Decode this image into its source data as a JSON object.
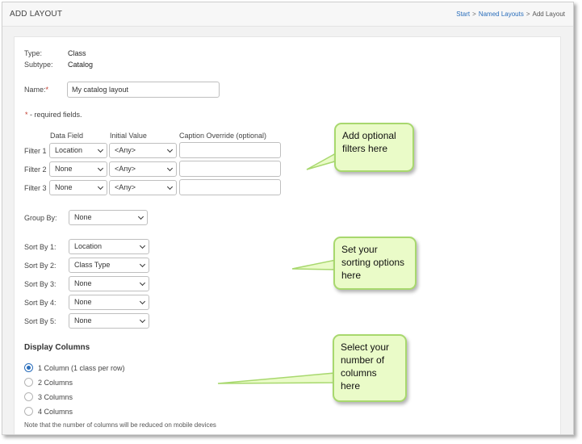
{
  "header": {
    "title": "ADD LAYOUT",
    "breadcrumb": {
      "start": "Start",
      "named_layouts": "Named Layouts",
      "current": "Add Layout",
      "sep": ">"
    }
  },
  "form": {
    "type_label": "Type:",
    "type_value": "Class",
    "subtype_label": "Subtype:",
    "subtype_value": "Catalog",
    "name_label": "Name:",
    "name_required_marker": "*",
    "name_value": "My catalog layout",
    "required_note_marker": "*",
    "required_note": " - required fields.",
    "filters": {
      "col_data_field": "Data Field",
      "col_initial_value": "Initial Value",
      "col_caption": "Caption Override (optional)",
      "rows": [
        {
          "label": "Filter 1",
          "data_field": "Location",
          "initial_value": "<Any>",
          "caption": ""
        },
        {
          "label": "Filter 2",
          "data_field": "None",
          "initial_value": "<Any>",
          "caption": ""
        },
        {
          "label": "Filter 3",
          "data_field": "None",
          "initial_value": "<Any>",
          "caption": ""
        }
      ]
    },
    "group_by_label": "Group By:",
    "group_by_value": "None",
    "sort_by": [
      {
        "label": "Sort By 1:",
        "value": "Location"
      },
      {
        "label": "Sort By 2:",
        "value": "Class Type"
      },
      {
        "label": "Sort By 3:",
        "value": "None"
      },
      {
        "label": "Sort By 4:",
        "value": "None"
      },
      {
        "label": "Sort By 5:",
        "value": "None"
      }
    ],
    "display_columns": {
      "title": "Display Columns",
      "options": [
        {
          "label": "1 Column (1 class per row)",
          "checked": true
        },
        {
          "label": "2 Columns",
          "checked": false
        },
        {
          "label": "3 Columns",
          "checked": false
        },
        {
          "label": "4 Columns",
          "checked": false
        }
      ],
      "note": "Note that the number of columns will be reduced on mobile devices"
    }
  },
  "callouts": {
    "filters": "Add optional filters here",
    "sorting": "Set your sorting options here",
    "columns": "Select your number of columns here"
  },
  "colors": {
    "accent": "#2a6ebb",
    "required": "#c0392b",
    "callout_bg": "#eafbc8",
    "callout_border": "#a8d86e"
  }
}
